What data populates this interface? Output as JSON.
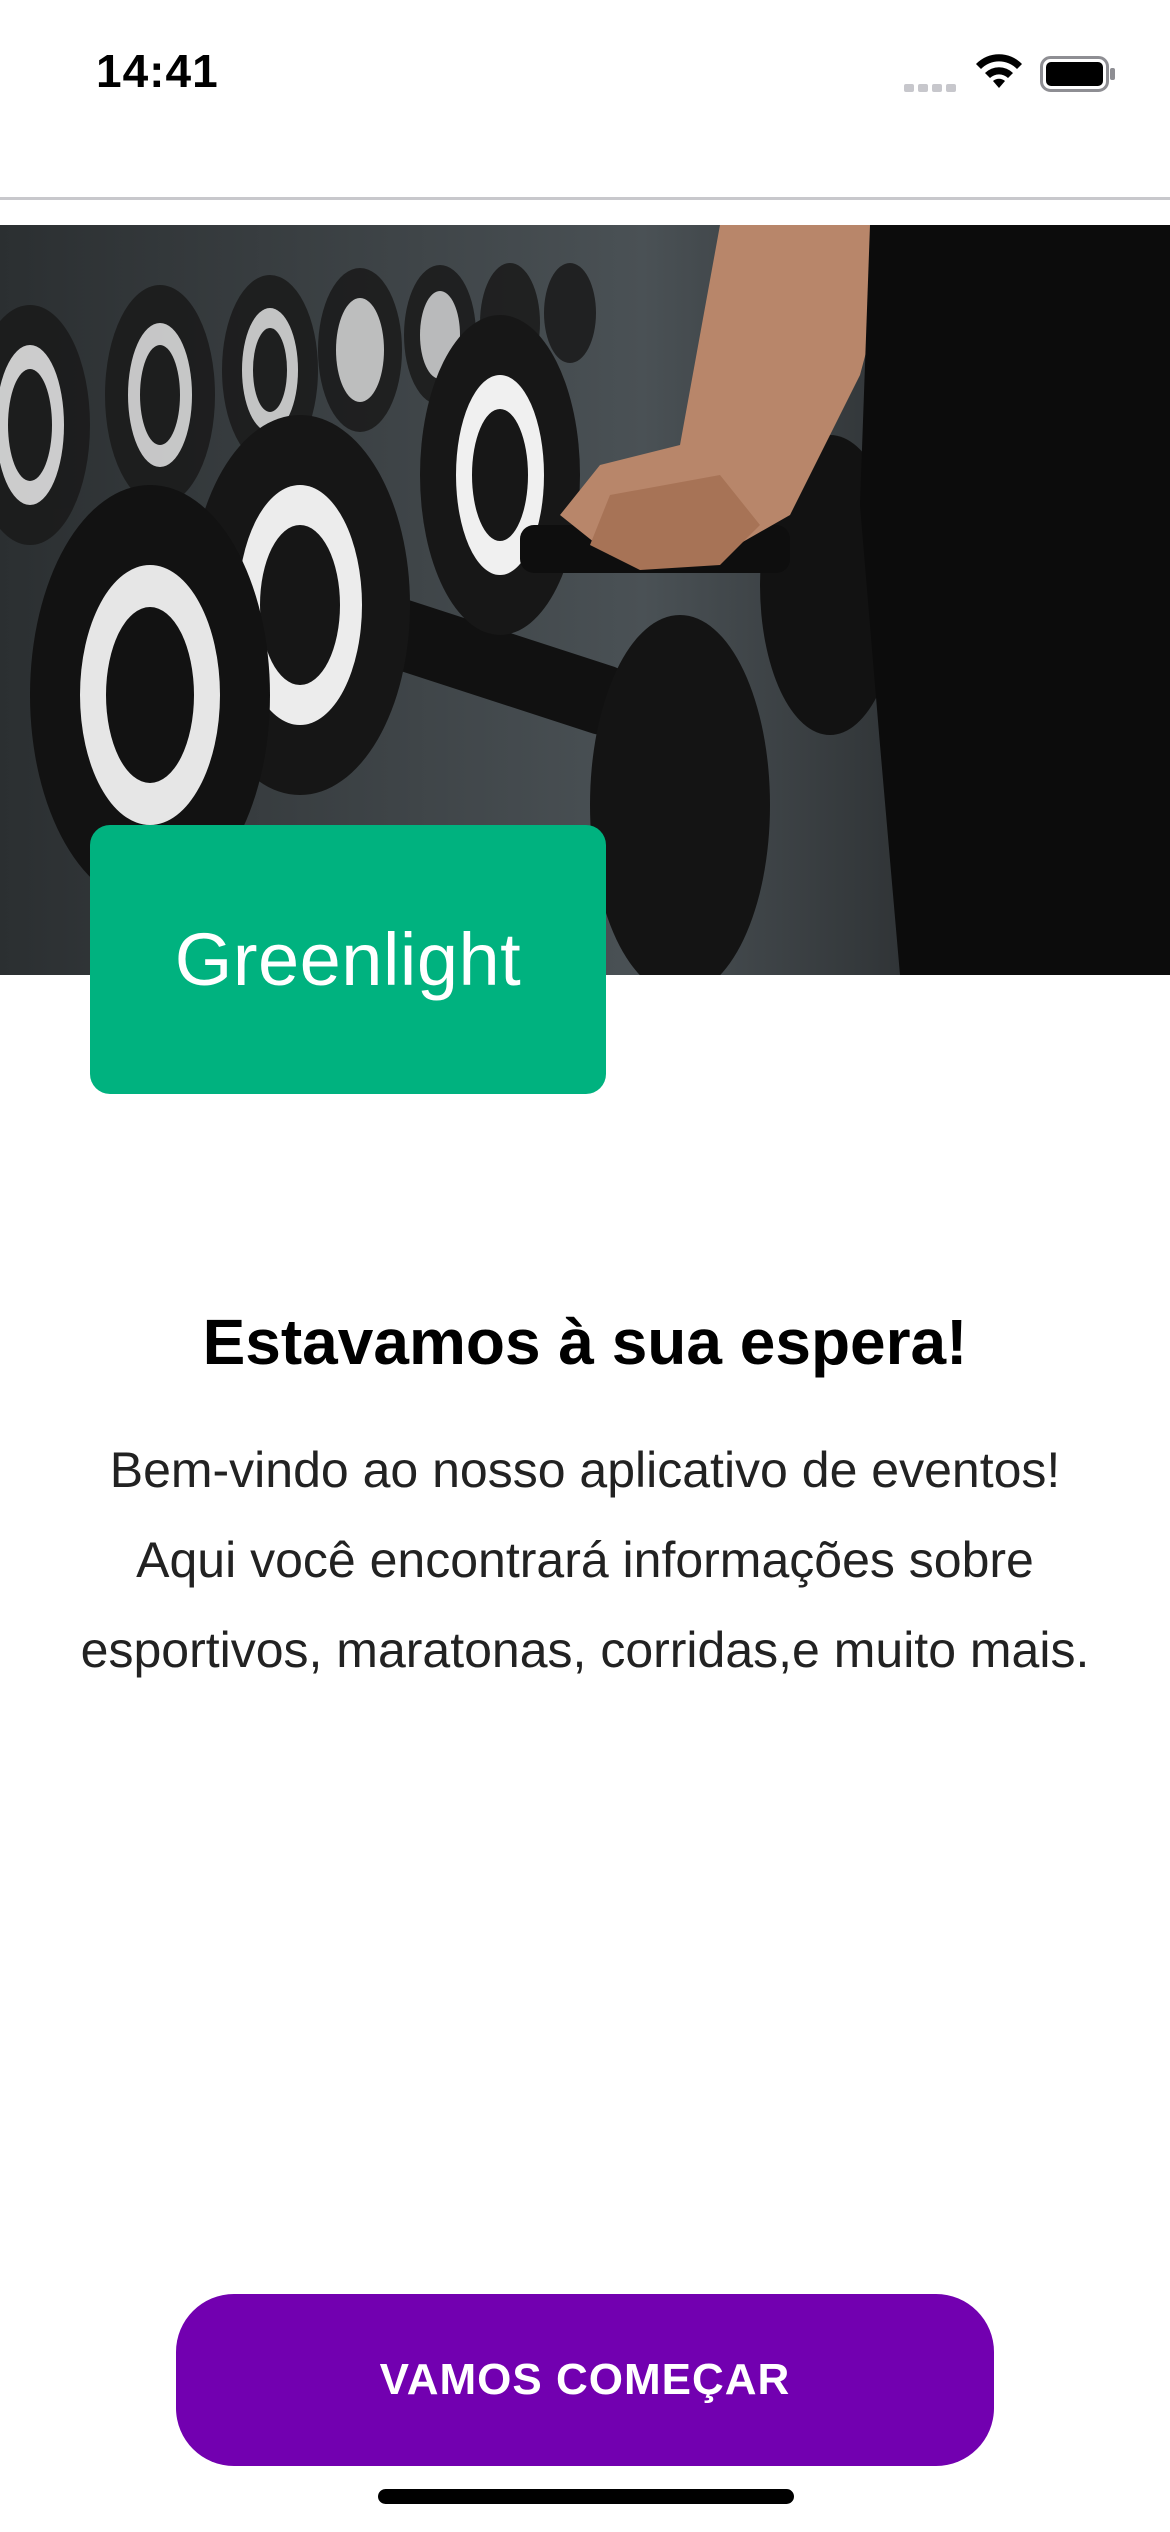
{
  "status_bar": {
    "time": "14:41"
  },
  "hero": {
    "image_subject": "gym-dumbbells-photo"
  },
  "brand": {
    "name": "Greenlight",
    "color": "#00b27f"
  },
  "welcome": {
    "title": "Estavamos à sua espera!",
    "body_lines": [
      "Bem-vindo ao nosso aplicativo de eventos!",
      "Aqui você encontrará informações sobre",
      "esportivos, maratonas, corridas,e muito mais."
    ]
  },
  "cta": {
    "label": "VAMOS COMEÇAR",
    "color": "#7200b0"
  }
}
